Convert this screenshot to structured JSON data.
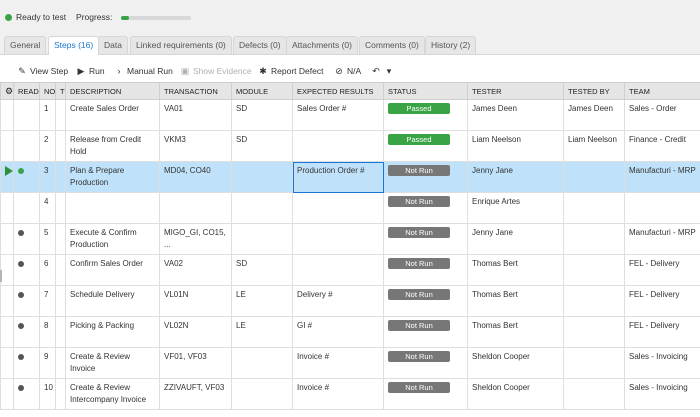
{
  "status": {
    "text": "Ready to test",
    "progress_label": "Progress:",
    "progress_fraction": 0.12,
    "color": "#3aa345"
  },
  "tabs": [
    {
      "label": "General"
    },
    {
      "label": "Steps (16)"
    },
    {
      "label": "Data"
    },
    {
      "label": "Linked requirements (0)"
    },
    {
      "label": "Defects (0)"
    },
    {
      "label": "Attachments (0)"
    },
    {
      "label": "Comments (0)"
    },
    {
      "label": "History (2)"
    }
  ],
  "toolbar": {
    "view_step": "View Step",
    "run": "Run",
    "manual_run": "Manual Run",
    "show_evidence": "Show Evidence",
    "report_defect": "Report Defect",
    "na": "N/A"
  },
  "columns": {
    "gear": "",
    "ready": "READY",
    "no": "NO",
    "test": "TEST",
    "description": "DESCRIPTION",
    "transaction": "TRANSACTION",
    "module": "MODULE",
    "expected": "EXPECTED RESULTS",
    "status": "STATUS",
    "tester": "TESTER",
    "tested_by": "TESTED BY",
    "team": "TEAM"
  },
  "rows": [
    {
      "no": "1",
      "description": "Create Sales Order",
      "transaction": "VA01",
      "module": "SD",
      "expected": "Sales Order #",
      "status": "Passed",
      "tester": "James Deen",
      "tested_by": "James Deen",
      "team": "Sales - Order"
    },
    {
      "no": "2",
      "description": "Release from Credit Hold",
      "transaction": "VKM3",
      "module": "SD",
      "expected": "",
      "status": "Passed",
      "tester": "Liam Neelson",
      "tested_by": "Liam Neelson",
      "team": "Finance - Credit"
    },
    {
      "no": "3",
      "description": "Plan & Prepare Production",
      "transaction": "MD04, CO40",
      "module": "",
      "expected": "Production Order #",
      "status": "Not Run",
      "tester": "Jenny Jane",
      "tested_by": "",
      "team": "Manufacturi - MRP"
    },
    {
      "no": "4",
      "description": "",
      "transaction": "",
      "module": "",
      "expected": "",
      "status": "Not Run",
      "tester": "Enrique Artes",
      "tested_by": "",
      "team": ""
    },
    {
      "no": "5",
      "description": "Execute & Confirm Production",
      "transaction": "MIGO_GI, CO15, ...",
      "module": "",
      "expected": "",
      "status": "Not Run",
      "tester": "Jenny Jane",
      "tested_by": "",
      "team": "Manufacturi - MRP"
    },
    {
      "no": "6",
      "description": "Confirm Sales Order",
      "transaction": "VA02",
      "module": "SD",
      "expected": "",
      "status": "Not Run",
      "tester": "Thomas Bert",
      "tested_by": "",
      "team": "FEL - Delivery"
    },
    {
      "no": "7",
      "description": "Schedule Delivery",
      "transaction": "VL01N",
      "module": "LE",
      "expected": "Delivery #",
      "status": "Not Run",
      "tester": "Thomas Bert",
      "tested_by": "",
      "team": "FEL - Delivery"
    },
    {
      "no": "8",
      "description": "Picking & Packing",
      "transaction": "VL02N",
      "module": "LE",
      "expected": "GI #",
      "status": "Not Run",
      "tester": "Thomas Bert",
      "tested_by": "",
      "team": "FEL - Delivery"
    },
    {
      "no": "9",
      "description": "Create & Review Invoice",
      "transaction": "VF01, VF03",
      "module": "",
      "expected": "Invoice #",
      "status": "Not Run",
      "tester": "Sheldon Cooper",
      "tested_by": "",
      "team": "Sales - Invoicing"
    },
    {
      "no": "10",
      "description": "Create & Review Intercompany Invoice",
      "transaction": "ZZIVAUFT, VF03",
      "module": "",
      "expected": "Invoice #",
      "status": "Not Run",
      "tester": "Sheldon Cooper",
      "tested_by": "",
      "team": "Sales - Invoicing"
    }
  ]
}
